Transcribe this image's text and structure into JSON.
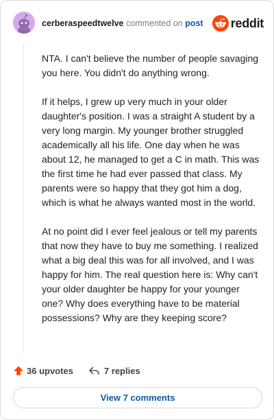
{
  "header": {
    "username": "cerberaspeedtwelve",
    "action_text": "commented on",
    "post_link": "post",
    "brand_name": "reddit",
    "avatar_color": "#d6a8f0",
    "brand_color": "#ff4500",
    "avatar_icon": "snoo-avatar-icon",
    "brand_icon": "reddit-snoo-icon"
  },
  "comment": {
    "paragraphs": [
      "NTA. I can't believe the number of people savaging you here. You didn't do anything wrong.",
      "If it helps, I grew up very much in your older daughter's position. I was a straight A student by a very long margin. My younger brother struggled academically all his life. One day when he was about 12, he managed to get a C in math. This was the first time he had ever passed that class. My parents were so happy that they got him a dog, which is what he always wanted most in the world.",
      "At no point did I ever feel jealous or tell my parents that now they have to buy me something. I realized what a big deal this was for all involved, and I was happy for him. The real question here is: Why can't your older daughter be happy for your younger one? Why does everything have to be material possessions? Why are they keeping score?"
    ]
  },
  "footer": {
    "upvotes": "36 upvotes",
    "replies": "7 replies",
    "upvote_icon": "upvote-arrow-icon",
    "reply_icon": "reply-arrow-icon",
    "upvote_color": "#ff4500"
  },
  "view_button": {
    "label": "View 7 comments",
    "color": "#0a58a6"
  }
}
